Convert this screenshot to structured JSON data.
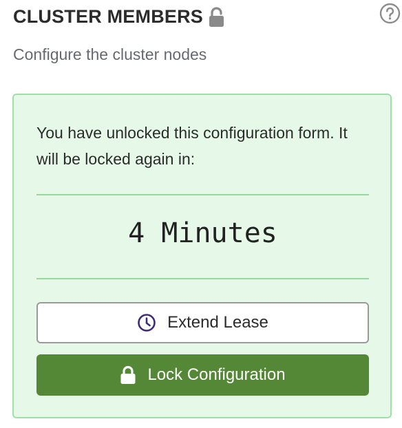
{
  "header": {
    "title": "CLUSTER MEMBERS",
    "lock_state_icon": "unlock-icon",
    "help_icon": "help-circle-icon"
  },
  "subtitle": "Configure the cluster nodes",
  "lease": {
    "message": "You have unlocked this configuration form. It will be locked again in:",
    "countdown": "4 Minutes",
    "extend_button": {
      "label": "Extend Lease",
      "icon": "clock-icon"
    },
    "lock_button": {
      "label": "Lock Configuration",
      "icon": "lock-icon"
    }
  },
  "colors": {
    "lease_background": "#e6f9e8",
    "lease_border": "#9ee0a5",
    "lock_button_bg": "#548836",
    "clock_icon": "#3e2a78",
    "muted_text": "#666a6f"
  }
}
